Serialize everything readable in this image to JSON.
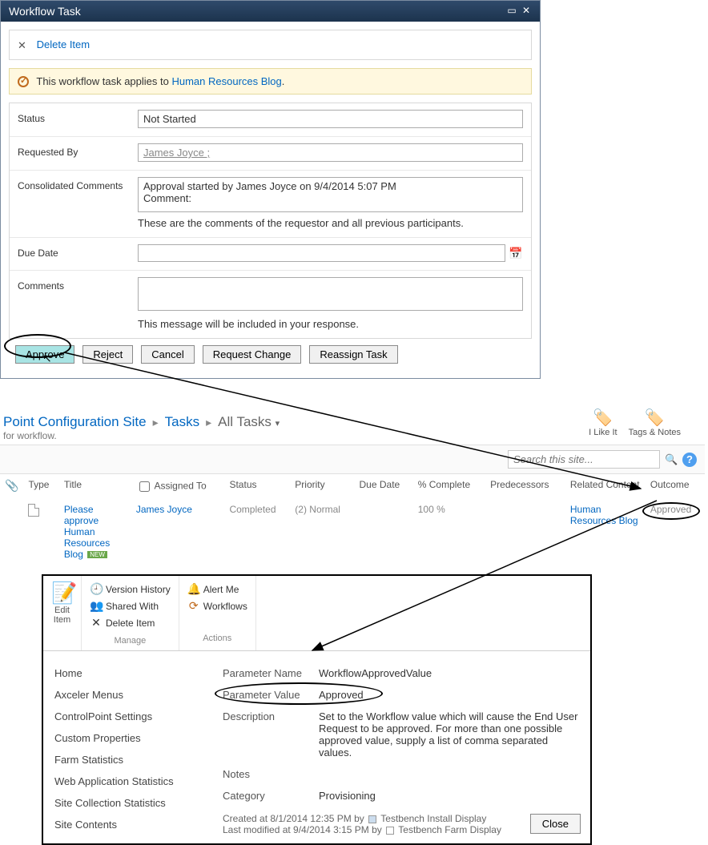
{
  "dialog": {
    "title": "Workflow Task",
    "delete_label": "Delete Item",
    "notice_prefix": "This workflow task applies to ",
    "notice_link": "Human Resources Blog",
    "notice_suffix": ".",
    "fields": {
      "status_label": "Status",
      "status_value": "Not Started",
      "requested_by_label": "Requested By",
      "requested_by_value": "James Joyce ;",
      "consolidated_label": "Consolidated Comments",
      "consolidated_value": "Approval started by James Joyce on 9/4/2014 5:07 PM\nComment:",
      "consolidated_help": "These are the comments of the requestor and all previous participants.",
      "due_label": "Due Date",
      "due_value": "",
      "comments_label": "Comments",
      "comments_value": "",
      "comments_help": "This message will be included in your response."
    },
    "buttons": {
      "approve": "Approve",
      "reject": "Reject",
      "cancel": "Cancel",
      "request_change": "Request Change",
      "reassign": "Reassign Task"
    }
  },
  "tasks": {
    "breadcrumb": {
      "site": "Point Configuration Site",
      "list": "Tasks",
      "view": "All Tasks"
    },
    "subtitle": "for workflow.",
    "like_label": "I Like It",
    "tags_label": "Tags & Notes",
    "search_placeholder": "Search this site...",
    "columns": {
      "type": "Type",
      "title": "Title",
      "assigned_to": "Assigned To",
      "status": "Status",
      "priority": "Priority",
      "due_date": "Due Date",
      "pct_complete": "% Complete",
      "predecessors": "Predecessors",
      "related_content": "Related Content",
      "outcome": "Outcome"
    },
    "row": {
      "title": "Please approve Human Resources Blog",
      "new_badge": "NEW",
      "assigned_to": "James Joyce",
      "status": "Completed",
      "priority": "(2) Normal",
      "due_date": "",
      "pct_complete": "100 %",
      "predecessors": "",
      "related_content": "Human Resources Blog",
      "outcome": "Approved"
    }
  },
  "detail": {
    "ribbon": {
      "edit_item": "Edit Item",
      "version_history": "Version History",
      "shared_with": "Shared With",
      "delete_item": "Delete Item",
      "alert_me": "Alert Me",
      "workflows": "Workflows",
      "group_manage": "Manage",
      "group_actions": "Actions"
    },
    "nav": [
      "Home",
      "Axceler Menus",
      "ControlPoint Settings",
      "Custom Properties",
      "Farm Statistics",
      "Web Application Statistics",
      "Site Collection Statistics",
      "Site Contents"
    ],
    "props": {
      "param_name_label": "Parameter Name",
      "param_name_value": "WorkflowApprovedValue",
      "param_value_label": "Parameter Value",
      "param_value_value": "Approved",
      "description_label": "Description",
      "description_value": "Set to the Workflow value which will cause the End User Request to be approved. For more than one possible approved value, supply a list of comma separated values.",
      "notes_label": "Notes",
      "notes_value": "",
      "category_label": "Category",
      "category_value": "Provisioning"
    },
    "footer": {
      "created_prefix": "Created at 8/1/2014 12:35 PM  by",
      "created_user": "Testbench Install Display",
      "modified_prefix": "Last modified at 9/4/2014 3:15 PM  by",
      "modified_user": "Testbench Farm Display"
    },
    "close_label": "Close"
  }
}
